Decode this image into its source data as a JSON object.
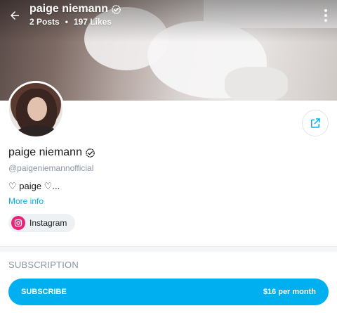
{
  "header": {
    "name": "paige niemann",
    "posts": "2 Posts",
    "separator": "•",
    "likes": "197 Likes"
  },
  "profile": {
    "name": "paige niemann",
    "handle": "@paigeniemannofficial",
    "bio": "♡ paige ♡...",
    "more_info": "More info"
  },
  "links": {
    "instagram_label": "Instagram"
  },
  "subscription": {
    "heading": "SUBSCRIPTION",
    "button_label": "SUBSCRIBE",
    "price": "$16 per month"
  },
  "colors": {
    "accent": "#00aff0",
    "instagram": "#e8247a",
    "muted_text": "#8a96a3"
  },
  "icons": {
    "back": "back-arrow-icon",
    "verified": "verified-badge-icon",
    "menu": "more-vertical-icon",
    "share": "share-icon",
    "instagram": "instagram-icon"
  }
}
